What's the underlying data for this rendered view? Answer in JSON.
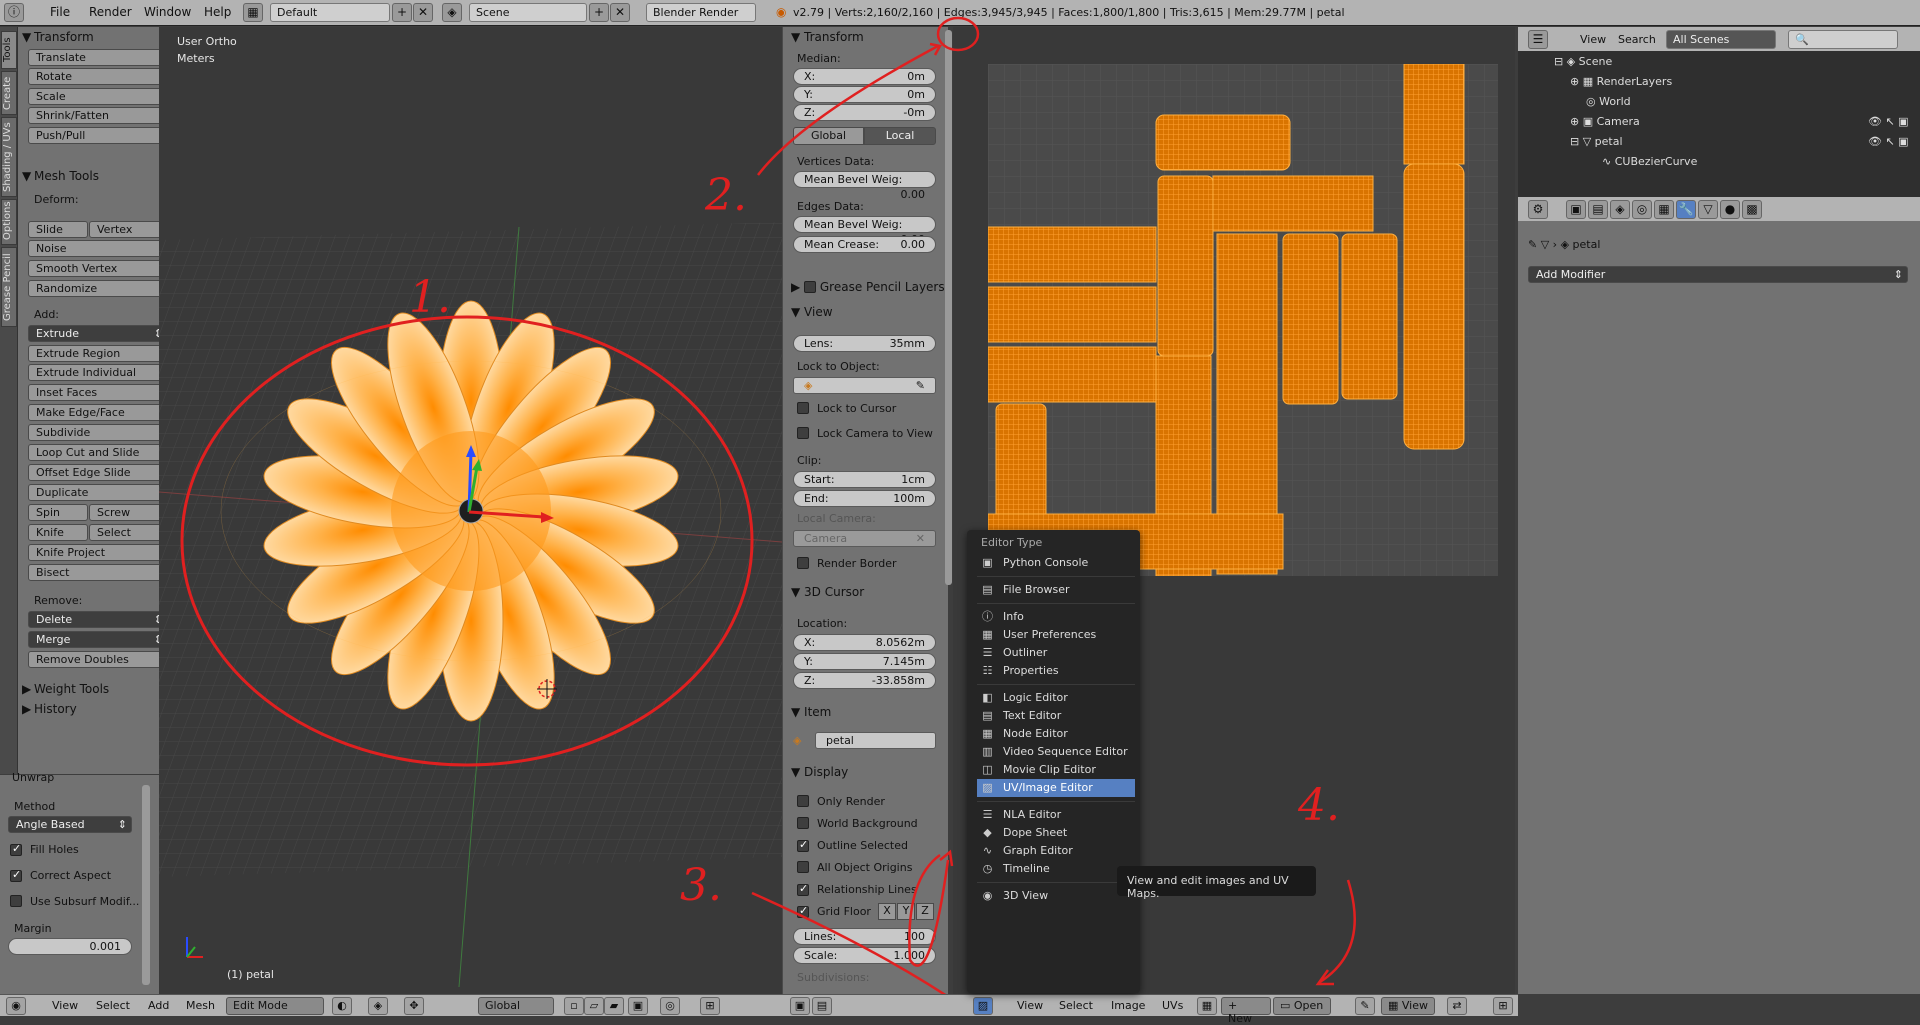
{
  "topbar": {
    "menus": [
      "File",
      "Render",
      "Window",
      "Help"
    ],
    "layout": "Default",
    "scene": "Scene",
    "engine": "Blender Render",
    "stats": "v2.79 | Verts:2,160/2,160 | Edges:3,945/3,945 | Faces:1,800/1,800 | Tris:3,615 | Mem:29.77M | petal"
  },
  "vtabs": [
    "Tools",
    "Create",
    "Shading / UVs",
    "Options",
    "Grease Pencil"
  ],
  "toolshelf": {
    "transform_title": "Transform",
    "transform_buttons": [
      "Translate",
      "Rotate",
      "Scale",
      "Shrink/Fatten",
      "Push/Pull"
    ],
    "mesh_tools_title": "Mesh Tools",
    "deform_label": "Deform:",
    "slide_edge": "Slide Edge",
    "vertex": "Vertex",
    "noise": "Noise",
    "smooth_vertex": "Smooth Vertex",
    "randomize": "Randomize",
    "add_label": "Add:",
    "extrude": "Extrude",
    "add_buttons": [
      "Extrude Region",
      "Extrude Individual",
      "Inset Faces",
      "Make Edge/Face",
      "Subdivide",
      "Loop Cut and Slide",
      "Offset Edge Slide",
      "Duplicate"
    ],
    "spin": "Spin",
    "screw": "Screw",
    "knife": "Knife",
    "select": "Select",
    "knife_project": "Knife Project",
    "bisect": "Bisect",
    "remove_label": "Remove:",
    "delete": "Delete",
    "merge": "Merge",
    "remove_doubles": "Remove Doubles",
    "weight_tools": "Weight Tools",
    "history": "History"
  },
  "unwrap": {
    "title": "Unwrap",
    "method_label": "Method",
    "method_value": "Angle Based",
    "fill_holes": "Fill Holes",
    "correct_aspect": "Correct Aspect",
    "use_subsurf": "Use Subsurf Modif...",
    "margin_label": "Margin",
    "margin_value": "0.001"
  },
  "viewport": {
    "view_name": "User Ortho",
    "units": "Meters",
    "object_label": "(1) petal",
    "annotations": [
      "1.",
      "2.",
      "3.",
      "4."
    ]
  },
  "npanel": {
    "transform_title": "Transform",
    "median_label": "Median:",
    "x_label": "X:",
    "x_value": "0m",
    "y_label": "Y:",
    "y_value": "0m",
    "z_label": "Z:",
    "z_value": "-0m",
    "global": "Global",
    "local": "Local",
    "vertices_data": "Vertices Data:",
    "mean_bevel_v": "Mean Bevel Weig:",
    "mean_bevel_v_val": "0.00",
    "edges_data": "Edges Data:",
    "mean_bevel_e": "Mean Bevel Weig:",
    "mean_bevel_e_val": "0.00",
    "mean_crease": "Mean Crease:",
    "mean_crease_val": "0.00",
    "grease_pencil": "Grease Pencil Layers",
    "view_title": "View",
    "lens_label": "Lens:",
    "lens_value": "35mm",
    "lock_object": "Lock to Object:",
    "lock_cursor": "Lock to Cursor",
    "lock_camera": "Lock Camera to View",
    "clip_label": "Clip:",
    "start_label": "Start:",
    "start_value": "1cm",
    "end_label": "End:",
    "end_value": "100m",
    "local_camera": "Local Camera:",
    "camera": "Camera",
    "render_border": "Render Border",
    "cursor_title": "3D Cursor",
    "location_label": "Location:",
    "cx": "8.0562m",
    "cy": "7.145m",
    "cz": "-33.858m",
    "item_title": "Item",
    "item_name": "petal",
    "display_title": "Display",
    "only_render": "Only Render",
    "world_background": "World Background",
    "outline_selected": "Outline Selected",
    "all_object_origins": "All Object Origins",
    "relationship_lines": "Relationship Lines",
    "grid_floor": "Grid Floor",
    "gx": "X",
    "gy": "Y",
    "gz": "Z",
    "lines_label": "Lines:",
    "lines_value": "100",
    "scale_label": "Scale:",
    "scale_value": "1.000",
    "subdivisions_label": "Subdivisions:"
  },
  "outliner": {
    "view": "View",
    "search": "Search",
    "scenes": "All Scenes",
    "items": [
      "Scene",
      "RenderLayers",
      "World",
      "Camera",
      "petal",
      "CUBezierCurve"
    ]
  },
  "properties": {
    "object": "petal",
    "add_modifier": "Add Modifier"
  },
  "bottom_3d": {
    "menus": [
      "View",
      "Select",
      "Add",
      "Mesh"
    ],
    "mode": "Edit Mode",
    "orientation": "Global"
  },
  "bottom_uv": {
    "menus": [
      "View",
      "Select",
      "Image",
      "UVs"
    ],
    "new": "New",
    "open": "Open",
    "view": "View"
  },
  "menu": {
    "title": "Editor Type",
    "items": [
      {
        "label": "Python Console",
        "icon": "▣"
      },
      {
        "label": "File Browser",
        "icon": "▤"
      },
      {
        "label": "Info",
        "icon": "ⓘ"
      },
      {
        "label": "User Preferences",
        "icon": "▦"
      },
      {
        "label": "Outliner",
        "icon": "☰"
      },
      {
        "label": "Properties",
        "icon": "☷"
      },
      {
        "label": "Logic Editor",
        "icon": "◧"
      },
      {
        "label": "Text Editor",
        "icon": "▤"
      },
      {
        "label": "Node Editor",
        "icon": "▦"
      },
      {
        "label": "Video Sequence Editor",
        "icon": "▥"
      },
      {
        "label": "Movie Clip Editor",
        "icon": "◫"
      },
      {
        "label": "UV/Image Editor",
        "icon": "▨"
      },
      {
        "label": "NLA Editor",
        "icon": "☰"
      },
      {
        "label": "Dope Sheet",
        "icon": "◆"
      },
      {
        "label": "Graph Editor",
        "icon": "∿"
      },
      {
        "label": "Timeline",
        "icon": "◷"
      },
      {
        "label": "3D View",
        "icon": "◉"
      }
    ],
    "tooltip": "View and edit images and UV Maps."
  },
  "colors": {
    "accent": "#5680c2",
    "uv_orange": "#ff8c00",
    "annotation_red": "#e02020"
  }
}
